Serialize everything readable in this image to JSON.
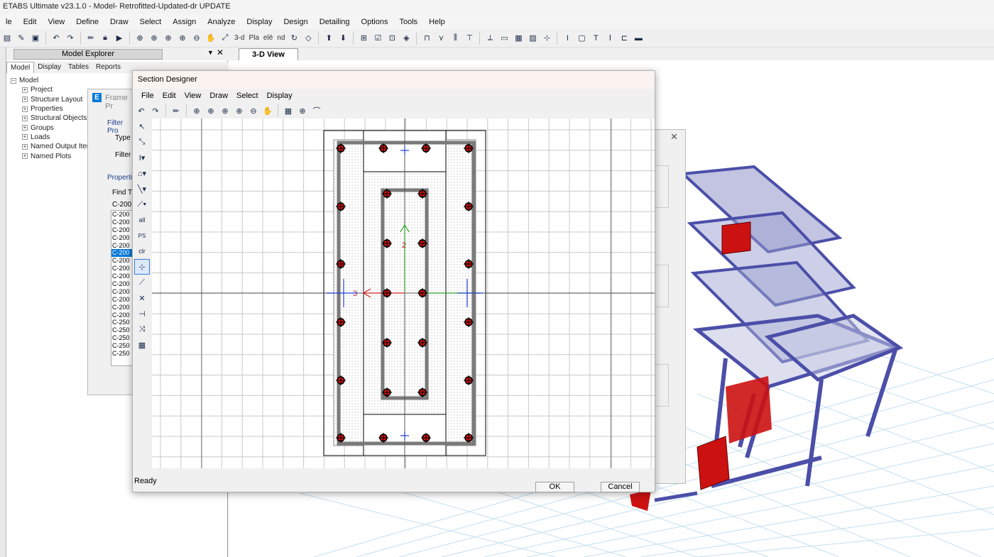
{
  "app": {
    "title": "ETABS Ultimate v23.1.0 - Model- Retrofitted-Updated-dr UPDATE"
  },
  "menu": [
    "le",
    "Edit",
    "View",
    "Define",
    "Draw",
    "Select",
    "Assign",
    "Analyze",
    "Display",
    "Design",
    "Detailing",
    "Options",
    "Tools",
    "Help"
  ],
  "toolbar": {
    "view_3d": "3-d",
    "plan": "Pla",
    "elev": "elē",
    "nd": "nd"
  },
  "explorer": {
    "title": "Model Explorer",
    "tabs": [
      "Model",
      "Display",
      "Tables",
      "Reports"
    ],
    "root": "Model",
    "items": [
      "Project",
      "Structure Layout",
      "Properties",
      "Structural Objects",
      "Groups",
      "Loads",
      "Named Output Item",
      "Named Plots"
    ]
  },
  "view": {
    "tab": "3-D View"
  },
  "frame_props": {
    "title": "Frame Pr",
    "filter_heading": "Filter Pro",
    "type_label": "Type",
    "filter_label": "Filter",
    "properties_heading": "Propertie",
    "find_label": "Find T",
    "find_value": "C-200",
    "list": [
      "C-200",
      "C-200",
      "C-200",
      "C-200",
      "C-200",
      "C-200",
      "C-200",
      "C-200",
      "C-200",
      "C-200",
      "C-200",
      "C-200",
      "C-200",
      "C-200",
      "C-250",
      "C-250",
      "C-250",
      "C-250",
      "C-250"
    ],
    "selected_index": 5
  },
  "section_designer": {
    "title": "Section Designer",
    "menu": [
      "File",
      "Edit",
      "View",
      "Draw",
      "Select",
      "Display"
    ],
    "side_labels": [
      "all",
      "PS",
      "clr"
    ],
    "axis_2": "2",
    "axis_3": "3",
    "status": "Ready",
    "ok_label": "OK",
    "cancel_label": "Cancel"
  },
  "colors": {
    "accent_blue": "#0078d7",
    "frame_blue": "#4b4fa8",
    "wall_red": "#cc1111",
    "grid": "#c8c8c8"
  }
}
